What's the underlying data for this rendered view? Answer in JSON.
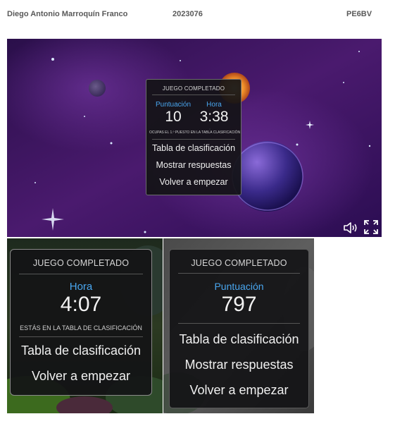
{
  "header": {
    "student_name": "Diego Antonio Marroquín Franco",
    "student_id": "2023076",
    "course_code": "PE6BV"
  },
  "screen1": {
    "title": "JUEGO COMPLETADO",
    "score_label": "Puntuación",
    "score_value": "10",
    "time_label": "Hora",
    "time_value": "3:38",
    "rank_note": "OCUPAS EL 1.º PUESTO EN LA TABLA CLASIFICACIÓN",
    "menu": [
      "Tabla de clasificación",
      "Mostrar respuestas",
      "Volver a empezar"
    ],
    "controls": {
      "sound_icon": "speaker-icon",
      "fullscreen_icon": "fullscreen-icon"
    }
  },
  "screen2": {
    "title": "JUEGO COMPLETADO",
    "time_label": "Hora",
    "time_value": "4:07",
    "rank_note": "ESTÁS EN LA TABLA DE CLASIFICACIÓN",
    "menu": [
      "Tabla de clasificación",
      "Volver a empezar"
    ]
  },
  "screen3": {
    "title": "JUEGO COMPLETADO",
    "score_label": "Puntuación",
    "score_value": "797",
    "menu": [
      "Tabla de clasificación",
      "Mostrar respuestas",
      "Volver a empezar"
    ]
  },
  "colors": {
    "label_blue": "#49a6ef",
    "panel_bg": "#141416",
    "space_purple": "#4a1a6e"
  }
}
